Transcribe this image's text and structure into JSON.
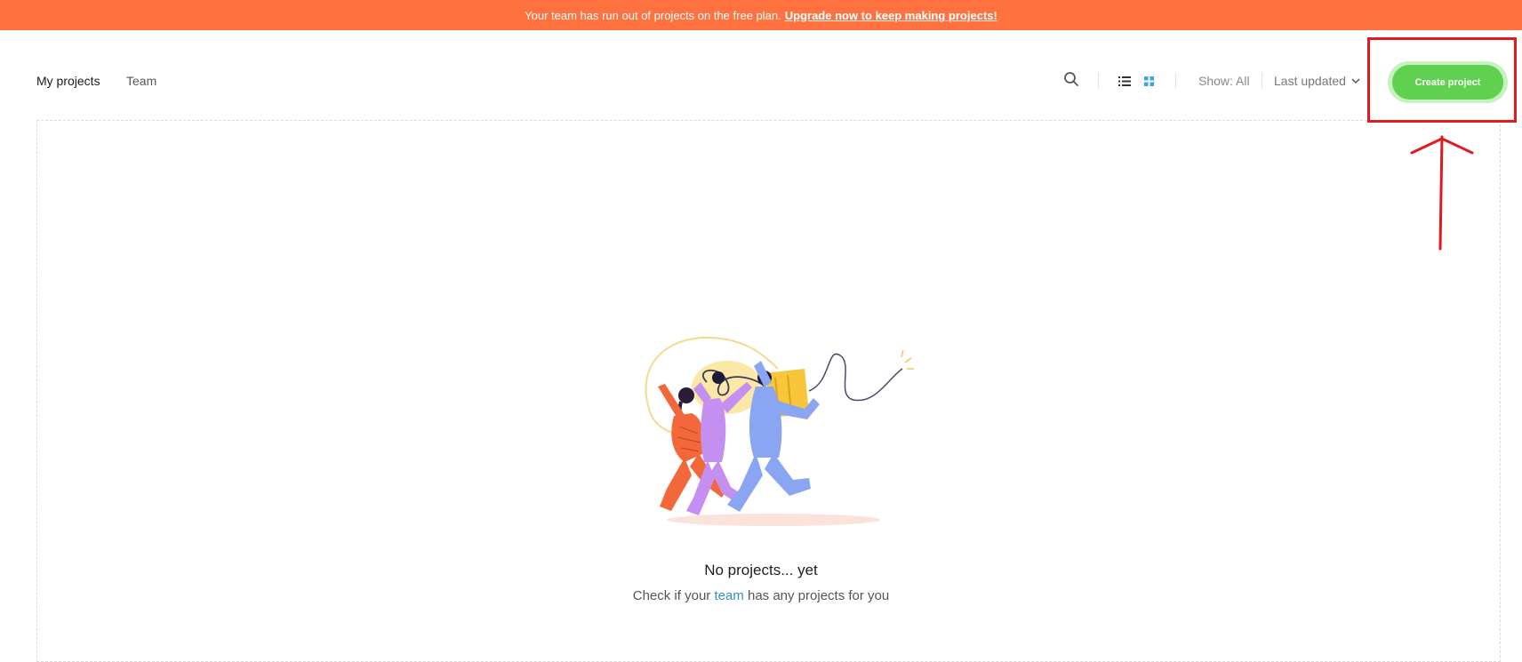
{
  "banner": {
    "text": "Your team has run out of projects on the free plan.",
    "link": "Upgrade now to keep making projects!"
  },
  "nav": {
    "tabs": [
      {
        "label": "My projects",
        "active": true
      },
      {
        "label": "Team",
        "active": false
      }
    ]
  },
  "toolbar": {
    "search_icon": "search-icon",
    "view_list_icon": "list-view-icon",
    "view_grid_icon": "grid-view-icon",
    "show_label": "Show: All",
    "sort_label": "Last updated",
    "create_label": "Create project"
  },
  "empty_state": {
    "title": "No projects... yet",
    "sub_before": "Check if your ",
    "sub_link": "team",
    "sub_after": " has any projects for you"
  },
  "colors": {
    "banner": "#ff7240",
    "create_button": "#5fd04f",
    "link": "#2f8fc7",
    "annotation": "#e01a22"
  }
}
